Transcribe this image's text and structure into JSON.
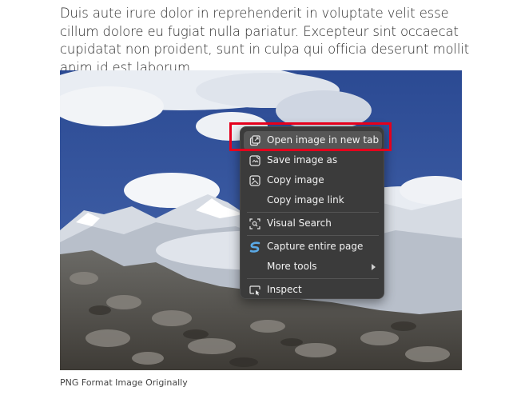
{
  "article": {
    "paragraph": "Duis aute irure dolor in reprehenderit in voluptate velit esse cillum dolore eu fugiat nulla pariatur. Excepteur sint occaecat cupidatat non proident, sunt in culpa qui officia deserunt mollit anim id est laborum.",
    "caption": "PNG Format Image Originally"
  },
  "context_menu": {
    "items": [
      {
        "label": "Open image in new tab",
        "icon": "new-tab-icon"
      },
      {
        "label": "Save image as",
        "icon": "save-image-icon"
      },
      {
        "label": "Copy image",
        "icon": "copy-image-icon"
      },
      {
        "label": "Copy image link",
        "icon": ""
      },
      {
        "label": "Visual Search",
        "icon": "visual-search-icon"
      },
      {
        "label": "Capture entire page",
        "icon": "capture-icon"
      },
      {
        "label": "More tools",
        "icon": ""
      },
      {
        "label": "Inspect",
        "icon": "inspect-icon"
      }
    ]
  },
  "colors": {
    "highlight": "#e5001c",
    "menu_bg": "#3b3b3b",
    "menu_hover": "#565656"
  }
}
